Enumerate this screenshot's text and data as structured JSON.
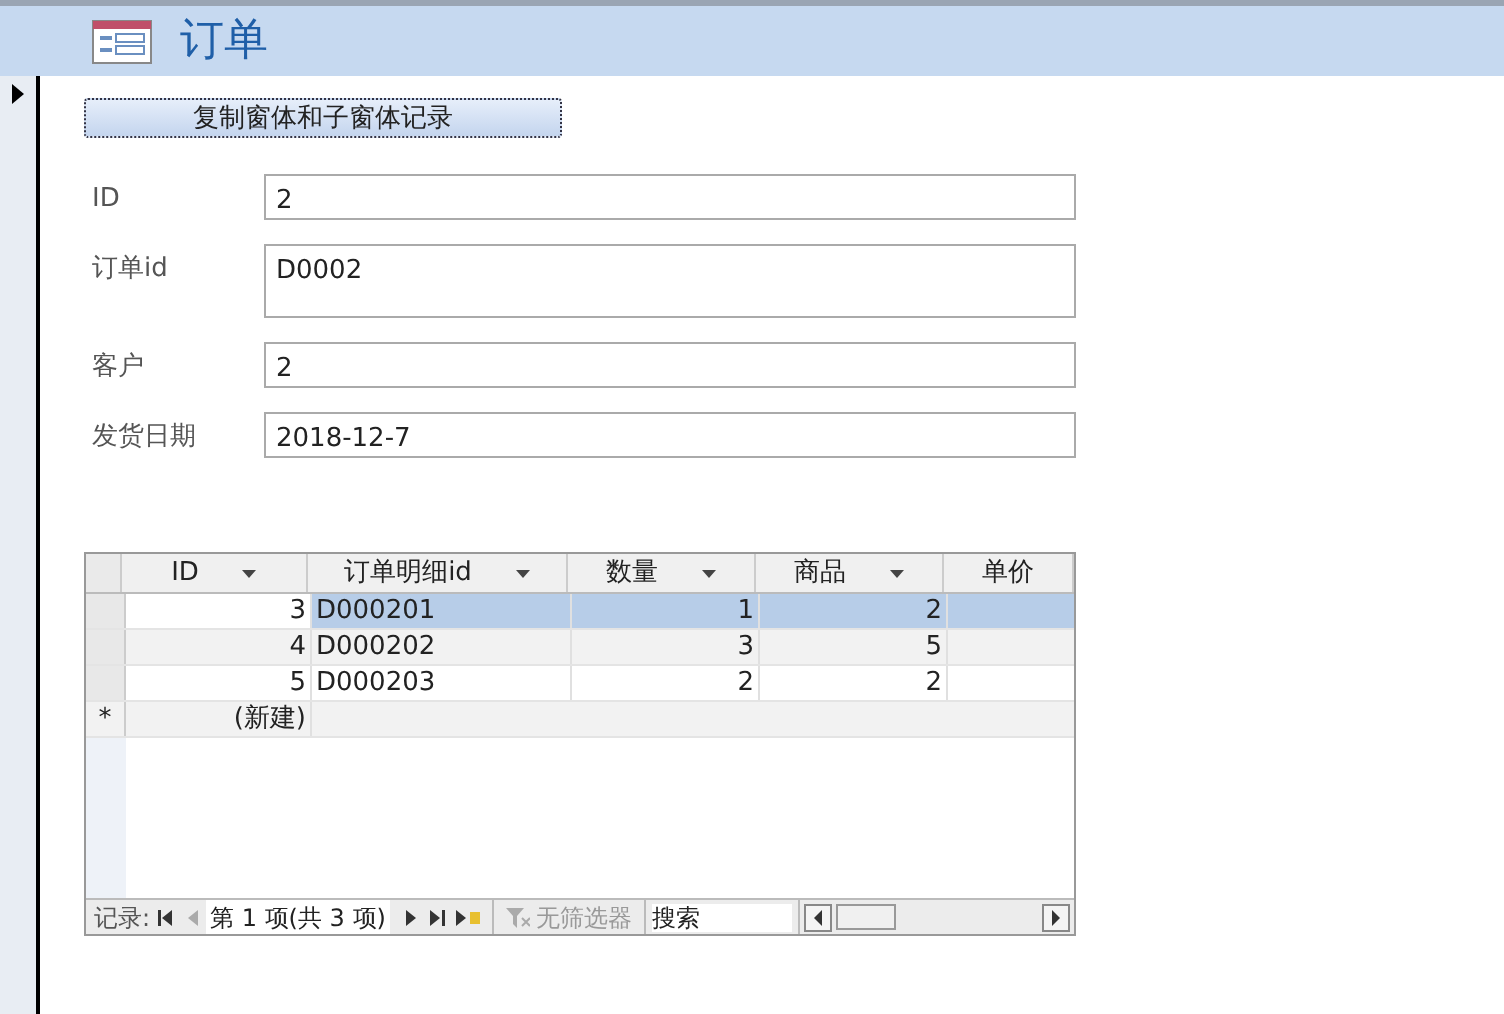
{
  "form": {
    "title": "订单"
  },
  "button": {
    "label": "复制窗体和子窗体记录"
  },
  "fields": [
    {
      "label": "ID",
      "value": "2",
      "kind": "single"
    },
    {
      "label": "订单id",
      "value": "D0002",
      "kind": "multi"
    },
    {
      "label": "客户",
      "value": "2",
      "kind": "single"
    },
    {
      "label": "发货日期",
      "value": "2018-12-7",
      "kind": "single"
    }
  ],
  "subform": {
    "columns": [
      "ID",
      "订单明细id",
      "数量",
      "商品",
      "单价"
    ],
    "rows": [
      {
        "cells": [
          "3",
          "D000201",
          "1",
          "2"
        ],
        "selected": true
      },
      {
        "cells": [
          "4",
          "D000202",
          "3",
          "5"
        ],
        "selected": false
      },
      {
        "cells": [
          "5",
          "D000203",
          "2",
          "2"
        ],
        "selected": false
      }
    ],
    "new_row": {
      "marker": "*",
      "label": "(新建)"
    },
    "nav": {
      "label": "记录:",
      "position": "第 1 项(共 3 项)",
      "filter": "无筛选器",
      "filter_disabled": true,
      "search": {
        "placeholder": "搜索"
      }
    }
  }
}
